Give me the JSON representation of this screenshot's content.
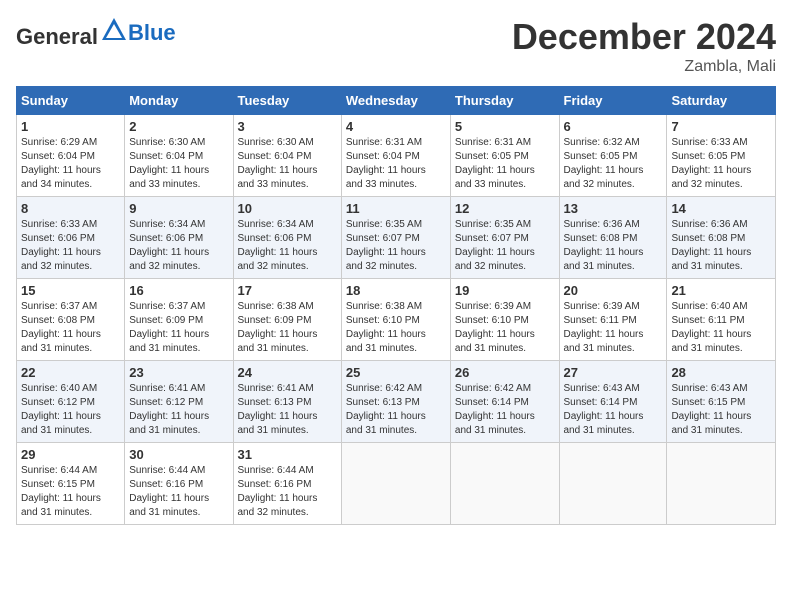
{
  "header": {
    "logo_general": "General",
    "logo_blue": "Blue",
    "month": "December 2024",
    "location": "Zambla, Mali"
  },
  "days_of_week": [
    "Sunday",
    "Monday",
    "Tuesday",
    "Wednesday",
    "Thursday",
    "Friday",
    "Saturday"
  ],
  "weeks": [
    [
      {
        "day": "1",
        "rise": "6:29 AM",
        "set": "6:04 PM",
        "hours": "11 hours and 34 minutes."
      },
      {
        "day": "2",
        "rise": "6:30 AM",
        "set": "6:04 PM",
        "hours": "11 hours and 33 minutes."
      },
      {
        "day": "3",
        "rise": "6:30 AM",
        "set": "6:04 PM",
        "hours": "11 hours and 33 minutes."
      },
      {
        "day": "4",
        "rise": "6:31 AM",
        "set": "6:04 PM",
        "hours": "11 hours and 33 minutes."
      },
      {
        "day": "5",
        "rise": "6:31 AM",
        "set": "6:05 PM",
        "hours": "11 hours and 33 minutes."
      },
      {
        "day": "6",
        "rise": "6:32 AM",
        "set": "6:05 PM",
        "hours": "11 hours and 32 minutes."
      },
      {
        "day": "7",
        "rise": "6:33 AM",
        "set": "6:05 PM",
        "hours": "11 hours and 32 minutes."
      }
    ],
    [
      {
        "day": "8",
        "rise": "6:33 AM",
        "set": "6:06 PM",
        "hours": "11 hours and 32 minutes."
      },
      {
        "day": "9",
        "rise": "6:34 AM",
        "set": "6:06 PM",
        "hours": "11 hours and 32 minutes."
      },
      {
        "day": "10",
        "rise": "6:34 AM",
        "set": "6:06 PM",
        "hours": "11 hours and 32 minutes."
      },
      {
        "day": "11",
        "rise": "6:35 AM",
        "set": "6:07 PM",
        "hours": "11 hours and 32 minutes."
      },
      {
        "day": "12",
        "rise": "6:35 AM",
        "set": "6:07 PM",
        "hours": "11 hours and 32 minutes."
      },
      {
        "day": "13",
        "rise": "6:36 AM",
        "set": "6:08 PM",
        "hours": "11 hours and 31 minutes."
      },
      {
        "day": "14",
        "rise": "6:36 AM",
        "set": "6:08 PM",
        "hours": "11 hours and 31 minutes."
      }
    ],
    [
      {
        "day": "15",
        "rise": "6:37 AM",
        "set": "6:08 PM",
        "hours": "11 hours and 31 minutes."
      },
      {
        "day": "16",
        "rise": "6:37 AM",
        "set": "6:09 PM",
        "hours": "11 hours and 31 minutes."
      },
      {
        "day": "17",
        "rise": "6:38 AM",
        "set": "6:09 PM",
        "hours": "11 hours and 31 minutes."
      },
      {
        "day": "18",
        "rise": "6:38 AM",
        "set": "6:10 PM",
        "hours": "11 hours and 31 minutes."
      },
      {
        "day": "19",
        "rise": "6:39 AM",
        "set": "6:10 PM",
        "hours": "11 hours and 31 minutes."
      },
      {
        "day": "20",
        "rise": "6:39 AM",
        "set": "6:11 PM",
        "hours": "11 hours and 31 minutes."
      },
      {
        "day": "21",
        "rise": "6:40 AM",
        "set": "6:11 PM",
        "hours": "11 hours and 31 minutes."
      }
    ],
    [
      {
        "day": "22",
        "rise": "6:40 AM",
        "set": "6:12 PM",
        "hours": "11 hours and 31 minutes."
      },
      {
        "day": "23",
        "rise": "6:41 AM",
        "set": "6:12 PM",
        "hours": "11 hours and 31 minutes."
      },
      {
        "day": "24",
        "rise": "6:41 AM",
        "set": "6:13 PM",
        "hours": "11 hours and 31 minutes."
      },
      {
        "day": "25",
        "rise": "6:42 AM",
        "set": "6:13 PM",
        "hours": "11 hours and 31 minutes."
      },
      {
        "day": "26",
        "rise": "6:42 AM",
        "set": "6:14 PM",
        "hours": "11 hours and 31 minutes."
      },
      {
        "day": "27",
        "rise": "6:43 AM",
        "set": "6:14 PM",
        "hours": "11 hours and 31 minutes."
      },
      {
        "day": "28",
        "rise": "6:43 AM",
        "set": "6:15 PM",
        "hours": "11 hours and 31 minutes."
      }
    ],
    [
      {
        "day": "29",
        "rise": "6:44 AM",
        "set": "6:15 PM",
        "hours": "11 hours and 31 minutes."
      },
      {
        "day": "30",
        "rise": "6:44 AM",
        "set": "6:16 PM",
        "hours": "11 hours and 31 minutes."
      },
      {
        "day": "31",
        "rise": "6:44 AM",
        "set": "6:16 PM",
        "hours": "11 hours and 32 minutes."
      },
      null,
      null,
      null,
      null
    ]
  ],
  "labels": {
    "sunrise": "Sunrise:",
    "sunset": "Sunset:",
    "daylight": "Daylight:"
  }
}
